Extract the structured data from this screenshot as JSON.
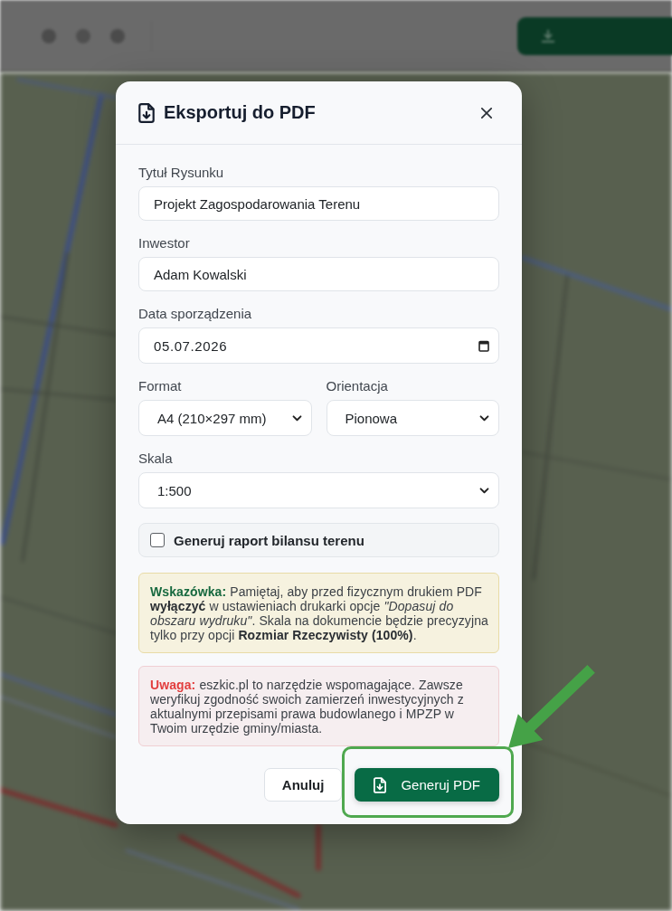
{
  "dialog": {
    "title": "Eksportuj do PDF"
  },
  "form_rows": [
    [
      {
        "kind": "text",
        "label": "Tytuł Rysunku",
        "value": "Projekt Zagospodarowania Terenu"
      }
    ],
    [
      {
        "kind": "text",
        "label": "Inwestor",
        "value": "Adam Kowalski"
      }
    ],
    [
      {
        "kind": "date",
        "label": "Data sporządzenia",
        "value": "05.07.2026"
      }
    ],
    [
      {
        "kind": "select",
        "label": "Format",
        "value": "A4 (210×297 mm)"
      },
      {
        "kind": "select",
        "label": "Orientacja",
        "value": "Pionowa"
      }
    ],
    [
      {
        "kind": "select",
        "label": "Skala",
        "value": "1:500"
      }
    ]
  ],
  "report_option": {
    "label": "Generuj raport bilansu terenu",
    "checked": false
  },
  "notes": [
    {
      "kind": "tip",
      "label": "Wskazówka:",
      "text": "Pamiętaj, aby przed fizycznym drukiem PDF **wyłączyć** w ustawieniach drukarki opcje *\"Dopasuj do obszaru wydruku\"*. Skala na dokumencie będzie precyzyjna tylko przy opcji **Rozmiar Rzeczywisty (100%)**."
    },
    {
      "kind": "warning",
      "label": "Uwaga:",
      "text": "eszkic.pl to narzędzie wspomagające. Zawsze weryfikuj zgodność swoich zamierzeń inwestycyjnych z aktualnymi przepisami prawa budowlanego i MPZP w Twoim urzędzie gminy/miasta."
    }
  ],
  "buttons": [
    {
      "kind": "secondary",
      "label": "Anuluj",
      "highlighted": false
    },
    {
      "kind": "primary",
      "label": "Generuj PDF",
      "highlighted": true
    }
  ]
}
